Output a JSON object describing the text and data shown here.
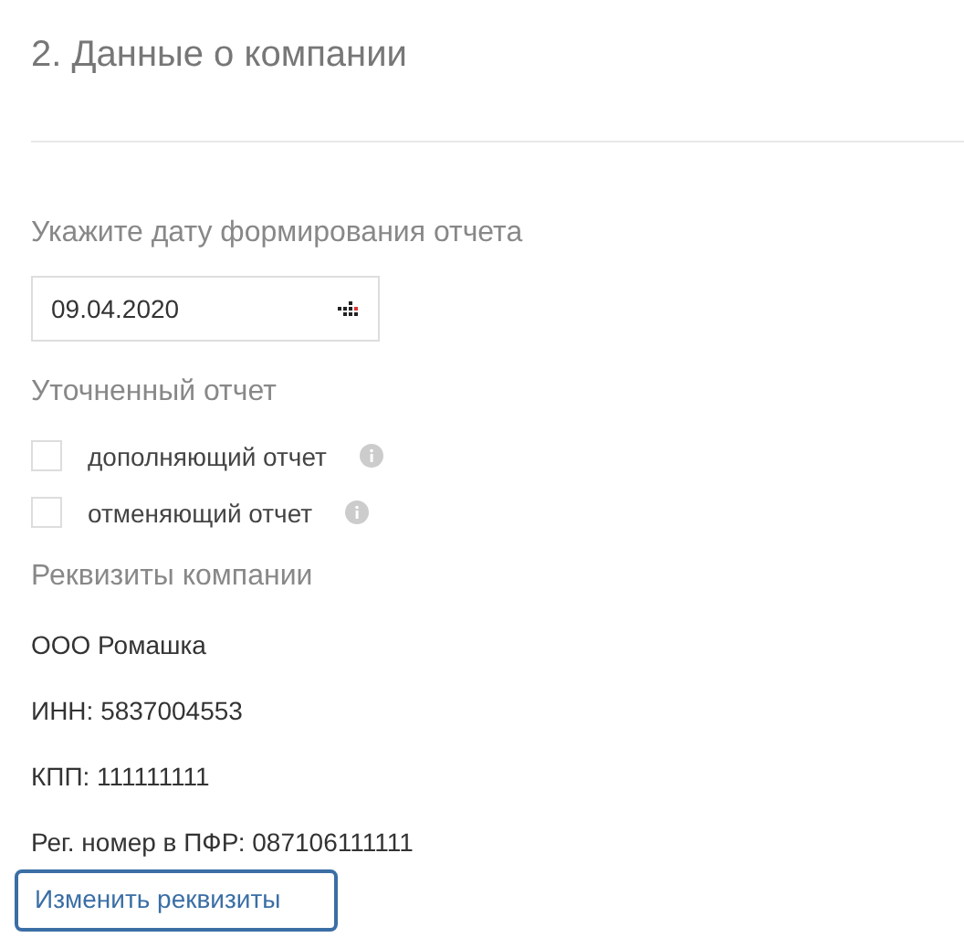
{
  "section_title": "2. Данные о компании",
  "date_field": {
    "label": "Укажите дату формирования отчета",
    "value": "09.04.2020"
  },
  "clarified_report": {
    "label": "Уточненный отчет",
    "options": [
      {
        "label": "дополняющий отчет",
        "checked": false
      },
      {
        "label": "отменяющий отчет",
        "checked": false
      }
    ]
  },
  "company_details": {
    "label": "Реквизиты компании",
    "lines": [
      "ООО Ромашка",
      "ИНН: 5837004553",
      "КПП: 111111111",
      "Рег. номер в ПФР: 087106111111"
    ]
  },
  "edit_link": {
    "label": "Изменить реквизиты",
    "focused": true
  }
}
